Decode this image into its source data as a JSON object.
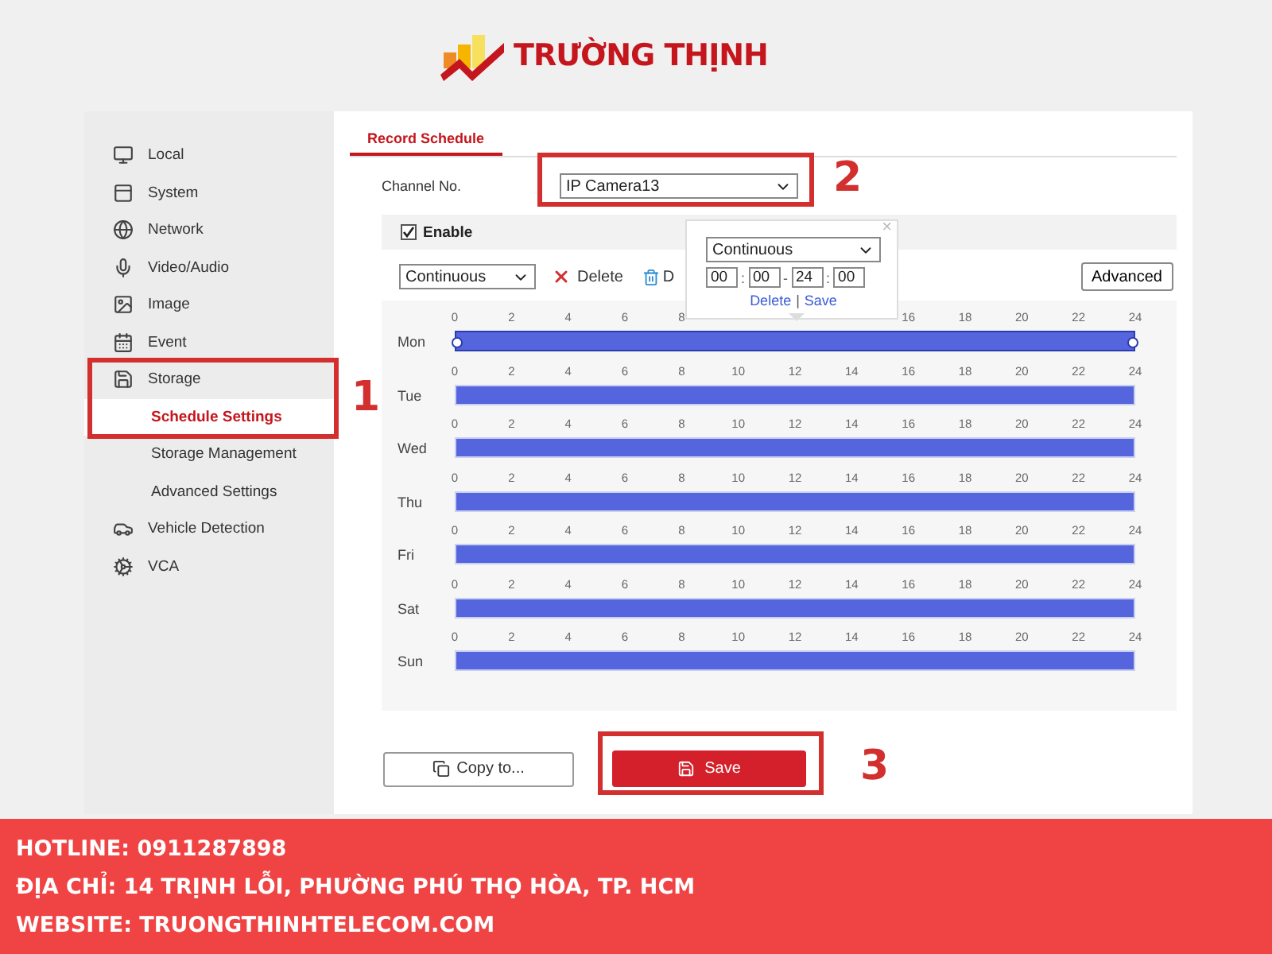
{
  "brand": {
    "name": "TRƯỜNG THỊNH"
  },
  "sidebar": {
    "annotation": "1",
    "items": [
      {
        "label": "Local",
        "selected": false
      },
      {
        "label": "System",
        "selected": false
      },
      {
        "label": "Network",
        "selected": false
      },
      {
        "label": "Video/Audio",
        "selected": false
      },
      {
        "label": "Image",
        "selected": false
      },
      {
        "label": "Event",
        "selected": false
      },
      {
        "label": "Storage",
        "selected": false,
        "expanded": true,
        "children": [
          {
            "label": "Schedule Settings",
            "selected": true
          },
          {
            "label": "Storage Management",
            "selected": false
          },
          {
            "label": "Advanced Settings",
            "selected": false
          }
        ]
      },
      {
        "label": "Vehicle Detection",
        "selected": false
      },
      {
        "label": "VCA",
        "selected": false
      }
    ]
  },
  "tabs": [
    {
      "label": "Record Schedule",
      "selected": true
    }
  ],
  "channel": {
    "label": "Channel No.",
    "value": "IP Camera13",
    "annotation": "2"
  },
  "enable": {
    "label": "Enable",
    "checked": true
  },
  "toolbar": {
    "mode": "Continuous",
    "delete": "Delete",
    "delete_all": "D",
    "advanced": "Advanced"
  },
  "popup": {
    "close": "×",
    "mode": "Continuous",
    "start_hour": "00",
    "start_minute": "00",
    "end_hour": "24",
    "end_minute": "00",
    "separators": [
      ":",
      "-",
      ":"
    ],
    "delete": "Delete",
    "separator": "|",
    "save": "Save"
  },
  "schedule": {
    "days": [
      {
        "label": "Mon",
        "selected": true,
        "level": 1,
        "ticks": [
          "0",
          "2",
          "4",
          "6",
          "8"
        ],
        "ticks_end": [
          "16",
          "18",
          "20",
          "22",
          "24"
        ]
      },
      {
        "label": "Tue",
        "selected": false,
        "level": 1,
        "ticks": [
          "0",
          "2",
          "4",
          "6",
          "8",
          "10",
          "12",
          "14",
          "16",
          "18",
          "20",
          "22",
          "24"
        ]
      },
      {
        "label": "Wed",
        "selected": false,
        "level": 1,
        "ticks": [
          "0",
          "2",
          "4",
          "6",
          "8",
          "10",
          "12",
          "14",
          "16",
          "18",
          "20",
          "22",
          "24"
        ]
      },
      {
        "label": "Thu",
        "selected": false,
        "level": 1,
        "ticks": [
          "0",
          "2",
          "4",
          "6",
          "8",
          "10",
          "12",
          "14",
          "16",
          "18",
          "20",
          "22",
          "24"
        ]
      },
      {
        "label": "Fri",
        "selected": false,
        "level": 1,
        "ticks": [
          "0",
          "2",
          "4",
          "6",
          "8",
          "10",
          "12",
          "14",
          "16",
          "18",
          "20",
          "22",
          "24"
        ]
      },
      {
        "label": "Sat",
        "selected": false,
        "level": 1,
        "ticks": [
          "0",
          "2",
          "4",
          "6",
          "8",
          "10",
          "12",
          "14",
          "16",
          "18",
          "20",
          "22",
          "24"
        ]
      },
      {
        "label": "Sun",
        "selected": false,
        "level": 1,
        "ticks": [
          "0",
          "2",
          "4",
          "6",
          "8",
          "10",
          "12",
          "14",
          "16",
          "18",
          "20",
          "22",
          "24"
        ]
      }
    ]
  },
  "buttons": {
    "copy": "Copy to...",
    "save": "Save",
    "annotation": "3"
  },
  "footer": {
    "lines": [
      "HOTLINE: 0911287898",
      "ĐỊA CHỈ: 14 TRỊNH LỖI, PHƯỜNG PHÚ THỌ HÒA, TP. HCM",
      "WEBSITE: TRUONGTHINHTELECOM.COM"
    ]
  }
}
